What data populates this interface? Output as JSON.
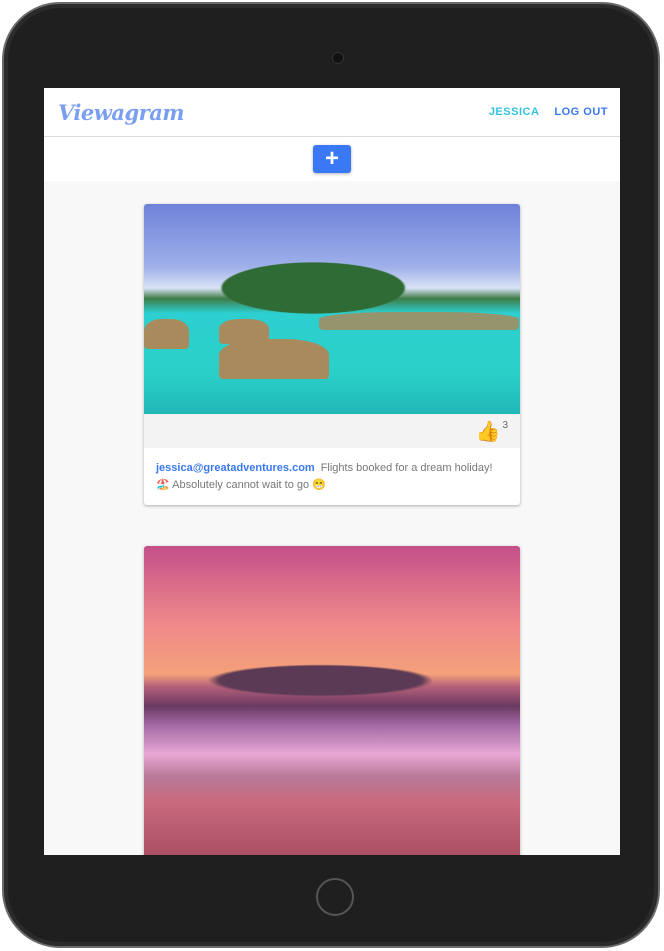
{
  "app": {
    "logo": "Viewagram"
  },
  "nav": {
    "user": "JESSICA",
    "logout": "LOG OUT"
  },
  "toolbar": {
    "add_label": "+"
  },
  "posts": [
    {
      "likes": "3",
      "author": "jessica@greatadventures.com",
      "text": "Flights booked for a dream holiday! 🏖️ Absolutely cannot wait to go 😁",
      "image": "overwater bungalows in turquoise lagoon"
    },
    {
      "image": "sunset over mountain and beach"
    }
  ],
  "icons": {
    "like": "thumbs-up-icon",
    "add": "plus-icon"
  },
  "colors": {
    "accent": "#3b78f6",
    "user": "#33c3e0"
  }
}
